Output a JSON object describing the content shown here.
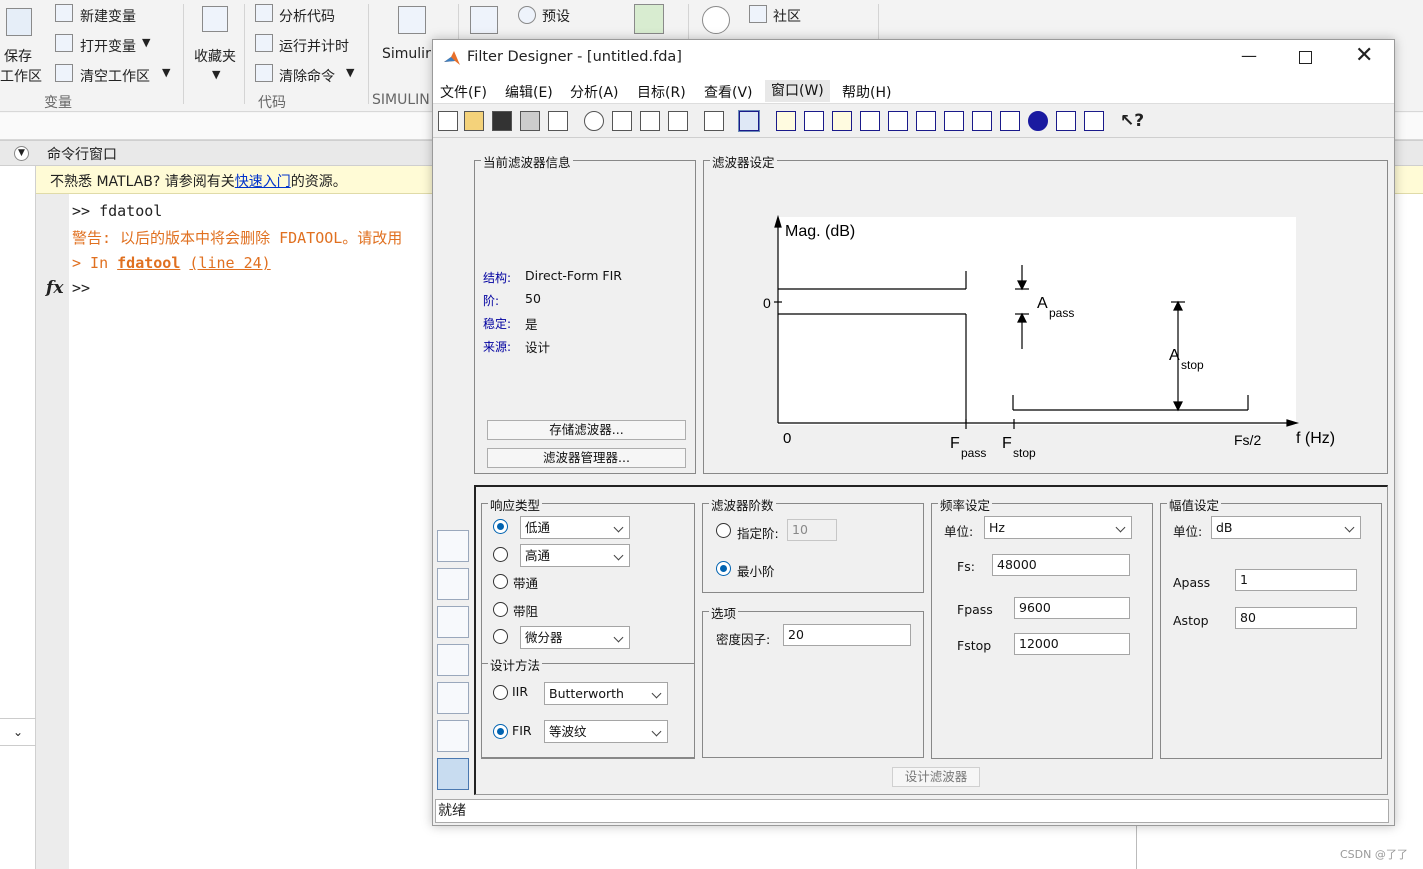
{
  "ribbon": {
    "save": "保存",
    "workspace": "工作区",
    "new_var": "新建变量",
    "open_var": "打开变量",
    "clear_ws": "清空工作区",
    "var_group": "变量",
    "favorites": "收藏夹",
    "analyze_code": "分析代码",
    "run_parallel": "运行并计时",
    "clear_cmd": "清除命令",
    "code_group": "代码",
    "simulink": "Simulir",
    "simulink_group": "SIMULIN",
    "preset": "预设",
    "community": "社区"
  },
  "command_window": {
    "title": "命令行窗口",
    "notice_pre": "不熟悉 MATLAB? 请参阅有关",
    "notice_link": "快速入门",
    "notice_post": "的资源。",
    "line1": ">> fdatool",
    "warning": "警告: 以后的版本中将会删除 FDATOOL。请改用",
    "in_pre": "> In ",
    "in_func": "fdatool",
    "in_line": "(line 24)",
    "prompt": ">>",
    "fx": "fx"
  },
  "fd": {
    "title": "Filter Designer - [untitled.fda]",
    "menu": [
      "文件(F)",
      "编辑(E)",
      "分析(A)",
      "目标(R)",
      "查看(V)",
      "窗口(W)",
      "帮助(H)"
    ],
    "current_info": {
      "title": "当前滤波器信息",
      "rows": [
        {
          "k": "结构:",
          "v": "Direct-Form FIR"
        },
        {
          "k": "阶:",
          "v": "50"
        },
        {
          "k": "稳定:",
          "v": "是"
        },
        {
          "k": "来源:",
          "v": "设计"
        }
      ],
      "store_btn": "存储滤波器...",
      "manager_btn": "滤波器管理器..."
    },
    "spec": {
      "title": "滤波器设定",
      "mag": "Mag. (dB)",
      "zero_y": "0",
      "zero_x": "0",
      "fpass": "F",
      "fpass_sub": "pass",
      "fstop": "F",
      "fstop_sub": "stop",
      "fs2": "Fs/2",
      "fhz": "f (Hz)",
      "apass": "A",
      "apass_sub": "pass",
      "astop": "A",
      "astop_sub": "stop"
    },
    "response": {
      "title": "响应类型",
      "lowpass": "低通",
      "highpass": "高通",
      "bandpass": "带通",
      "bandstop": "带阻",
      "diff": "微分器",
      "selected": "低通"
    },
    "method": {
      "title": "设计方法",
      "iir": "IIR",
      "iir_value": "Butterworth",
      "fir": "FIR",
      "fir_value": "等波纹",
      "selected": "FIR"
    },
    "order": {
      "title": "滤波器阶数",
      "specify": "指定阶:",
      "specify_value": "10",
      "minimum": "最小阶",
      "selected": "最小阶"
    },
    "options": {
      "title": "选项",
      "density_label": "密度因子:",
      "density_value": "20"
    },
    "freq": {
      "title": "频率设定",
      "unit_label": "单位:",
      "unit_value": "Hz",
      "fs_label": "Fs:",
      "fs_value": "48000",
      "fpass_label": "Fpass",
      "fpass_value": "9600",
      "fstop_label": "Fstop",
      "fstop_value": "12000"
    },
    "mag": {
      "title": "幅值设定",
      "unit_label": "单位:",
      "unit_value": "dB",
      "apass_label": "Apass",
      "apass_value": "1",
      "astop_label": "Astop",
      "astop_value": "80"
    },
    "design_btn": "设计滤波器",
    "status": "就绪"
  },
  "watermark": "CSDN @了了"
}
